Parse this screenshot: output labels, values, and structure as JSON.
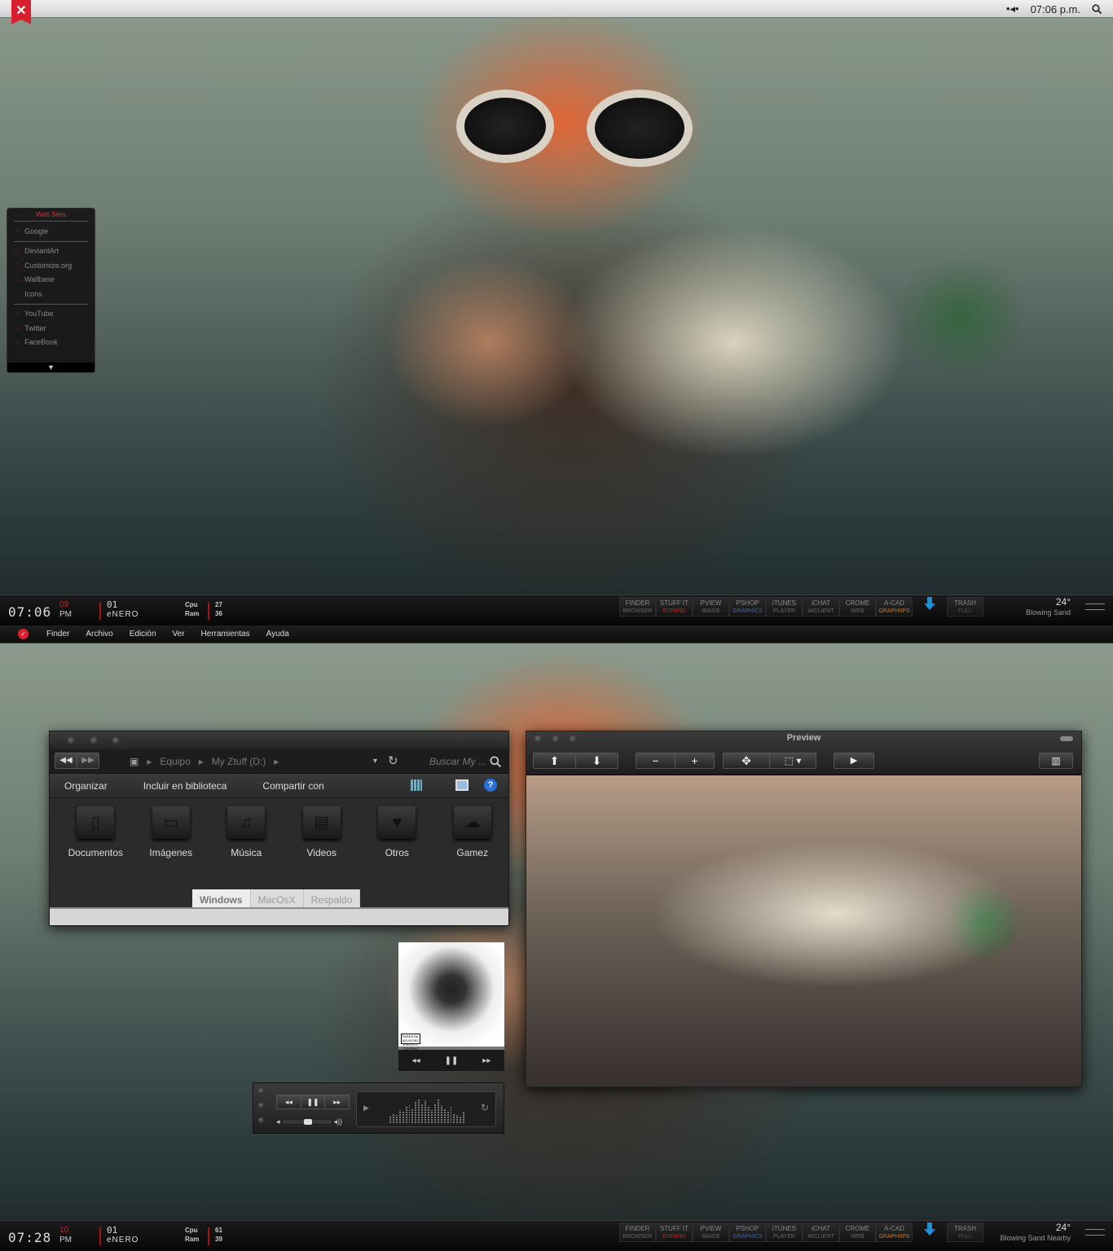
{
  "top_screen": {
    "menubar": {
      "close_glyph": "✕",
      "clock": "07:06 p.m.",
      "dots_icon": "•◂•",
      "search_icon": "search-icon"
    },
    "web_sites": {
      "title": "Web Sites",
      "groups": [
        [
          "Google"
        ],
        [
          "DeviantArt",
          "Customize.org",
          "Wallbase",
          "Icons"
        ],
        [
          "YouTube",
          "Twitter",
          "FaceBook"
        ]
      ],
      "more_glyph": "▼"
    },
    "taskbar": {
      "time": "07:06",
      "seconds": "09",
      "ampm": "PM",
      "day": "01",
      "month": "eNERO",
      "cpu_label": "Cpu",
      "ram_label": "Ram",
      "cpu": "27",
      "ram": "36",
      "weather_temp": "24°",
      "weather_desc": "Blowing Sand"
    }
  },
  "dock_apps": [
    {
      "top": "FINDER",
      "bottom": "BROWSER",
      "bottom_color": "#666666"
    },
    {
      "top": "STUFF IT",
      "bottom": "EXPAND",
      "bottom_color": "#cc2222"
    },
    {
      "top": "PVIEW",
      "bottom": "IMAGE",
      "bottom_color": "#666666"
    },
    {
      "top": "PSHOP",
      "bottom": "GRAPHICS",
      "bottom_color": "#3366cc"
    },
    {
      "top": "iTUNES",
      "bottom": "PLAYER",
      "bottom_color": "#666666"
    },
    {
      "top": "iCHAT",
      "bottom": "iMCLIENT",
      "bottom_color": "#666666"
    },
    {
      "top": "CROME",
      "bottom": "WEB",
      "bottom_color": "#666666"
    },
    {
      "top": "A-CAD",
      "bottom": "GRAPHIIPS",
      "bottom_color": "#cc7722"
    }
  ],
  "trash": {
    "top": "TRASH",
    "bottom": "FULL"
  },
  "finder_menu": {
    "items": [
      "Finder",
      "Archivo",
      "Edición",
      "Ver",
      "Herramientas",
      "Ayuda"
    ]
  },
  "explorer": {
    "back": "◀◀",
    "forward": "▶▶",
    "breadcrumbs": [
      "Equipo",
      "My Ztuff (D:)"
    ],
    "search_placeholder": "Buscar My ...",
    "toolbar": [
      "Organizar",
      "Incluir en biblioteca",
      "Compartir con"
    ],
    "folders": [
      {
        "label": "Documentos",
        "glyph": "▯"
      },
      {
        "label": "Imágenes",
        "glyph": "▭"
      },
      {
        "label": "Música",
        "glyph": "♫"
      },
      {
        "label": "Videos",
        "glyph": "▤"
      },
      {
        "label": "Otros",
        "glyph": "♥"
      },
      {
        "label": "Gamez",
        "glyph": "☁"
      }
    ],
    "tabs": [
      "Windows",
      "MacOsX",
      "Respaldo"
    ]
  },
  "preview": {
    "title": "Preview"
  },
  "album_widget": {
    "prev": "◂◂",
    "pause": "❚❚",
    "next": "▸▸",
    "advisory": "PARENTAL ADVISORY EXPLICIT CONTENT"
  },
  "itunes_widget": {
    "prev": "◂◂",
    "pause": "❚❚",
    "next": "▸▸",
    "vol_low": "◂",
    "vol_high": "◂))",
    "play_icon": "▶",
    "repeat_icon": "↻"
  },
  "bottom_screen": {
    "taskbar": {
      "time": "07:28",
      "seconds": "10",
      "ampm": "PM",
      "day": "01",
      "month": "eNERO",
      "cpu_label": "Cpu",
      "ram_label": "Ram",
      "cpu": "61",
      "ram": "39",
      "weather_temp": "24°",
      "weather_desc": "Blowing Sand Nearby"
    }
  },
  "colors": {
    "accent_red": "#d9202f",
    "download_blue": "#1e8fd6"
  }
}
